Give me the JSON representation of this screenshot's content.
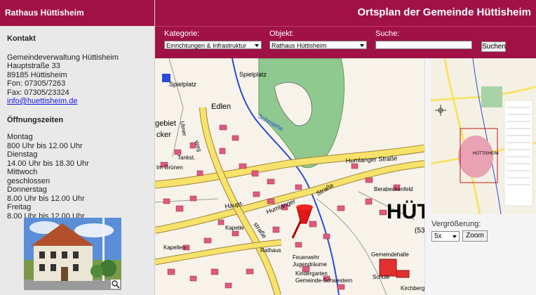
{
  "sidebar": {
    "title": "Rathaus Hüttisheim",
    "contact_heading": "Kontakt",
    "contact_lines": [
      "Gemeindeverwaltung Hüttisheim",
      "Hauptstraße 33",
      "89185 Hüttisheim",
      "Fon: 07305/7263",
      "Fax: 07305/23324"
    ],
    "email": "info@huettisheim.de",
    "hours_heading": "Öffnungszeiten",
    "hours_lines": [
      "Montag",
      "800 Uhr bis 12.00 Uhr",
      "Dienstag",
      "14.00 Uhr bis 18.30 Uhr",
      "Mittwoch",
      "geschlossen",
      "Donnerstag",
      "8.00 Uhr bis 12.00 Uhr",
      "Freitag",
      "8.00 Uhr bis 12.00 Uhr"
    ]
  },
  "header": {
    "title": "Ortsplan der Gemeinde Hüttisheim"
  },
  "toolbar": {
    "category_label": "Kategorie:",
    "category_value": "Einrichtungen & Infrastruktur",
    "object_label": "Objekt:",
    "object_value": "Rathaus Hüttisheim",
    "search_label": "Suche:",
    "search_value": "",
    "search_button": "Suchen"
  },
  "zoom": {
    "label": "Vergrößerung:",
    "value": "5x",
    "button": "Zoom"
  },
  "map": {
    "labels": {
      "spielplatz1": "Spielplatz",
      "spielplatz2": "Spielplatz",
      "edlen": "Edlen",
      "gebiet": "gebiet",
      "cker": "cker",
      "ulmer": "Ulmer",
      "weg": "Weg",
      "tankst": "Tankst.",
      "im_gruenen": "Im Grünen",
      "schmiehe": "Schmiehe",
      "humlanger_strasse": "Humlanger Straße",
      "humlanger": "Humlanger",
      "strasse": "Straße",
      "haupt": "Haupt-",
      "strasse2": "straße",
      "berabeckenfeld": "Berabeckenfeld",
      "kapelle": "Kapelle",
      "kapellen": "Kapellen-",
      "rathaus": "Rathaus",
      "feuerwehr": "Feuerwehr",
      "jugendraeume": "Jugendräume",
      "kindergarten": "Kindergarten",
      "gemeinde_schwestern": "Gemeinde-Schwestern",
      "gemeindehalle": "Gemeindehalle",
      "schule": "Schule",
      "big_town": "HÜTT",
      "num": "(53",
      "kirchberg": "Kirchberg",
      "overview_town": "HÜTTISHEIM"
    }
  },
  "colors": {
    "brand": "#a01245",
    "road": "#f7e36a",
    "building": "#e05a7d",
    "water": "#2a4bd6",
    "forest": "#8fc98f"
  }
}
